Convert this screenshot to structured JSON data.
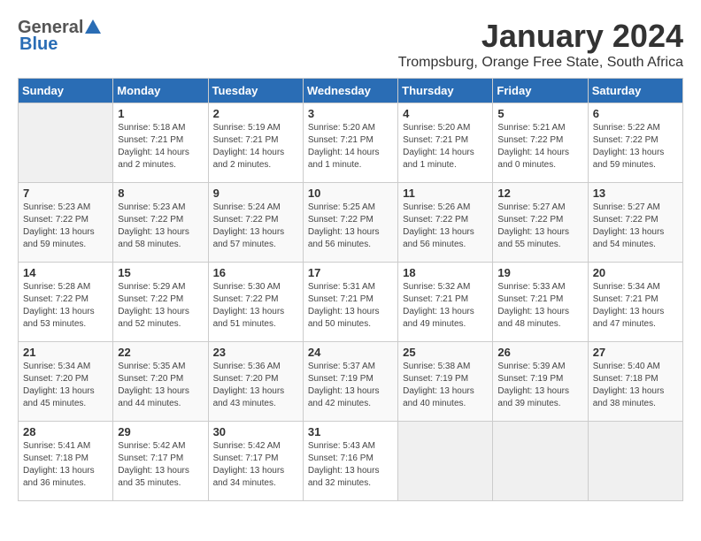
{
  "logo": {
    "general": "General",
    "blue": "Blue"
  },
  "title": "January 2024",
  "location": "Trompsburg, Orange Free State, South Africa",
  "days_header": [
    "Sunday",
    "Monday",
    "Tuesday",
    "Wednesday",
    "Thursday",
    "Friday",
    "Saturday"
  ],
  "weeks": [
    [
      {
        "day": "",
        "sunrise": "",
        "sunset": "",
        "daylight": ""
      },
      {
        "day": "1",
        "sunrise": "Sunrise: 5:18 AM",
        "sunset": "Sunset: 7:21 PM",
        "daylight": "Daylight: 14 hours and 2 minutes."
      },
      {
        "day": "2",
        "sunrise": "Sunrise: 5:19 AM",
        "sunset": "Sunset: 7:21 PM",
        "daylight": "Daylight: 14 hours and 2 minutes."
      },
      {
        "day": "3",
        "sunrise": "Sunrise: 5:20 AM",
        "sunset": "Sunset: 7:21 PM",
        "daylight": "Daylight: 14 hours and 1 minute."
      },
      {
        "day": "4",
        "sunrise": "Sunrise: 5:20 AM",
        "sunset": "Sunset: 7:21 PM",
        "daylight": "Daylight: 14 hours and 1 minute."
      },
      {
        "day": "5",
        "sunrise": "Sunrise: 5:21 AM",
        "sunset": "Sunset: 7:22 PM",
        "daylight": "Daylight: 14 hours and 0 minutes."
      },
      {
        "day": "6",
        "sunrise": "Sunrise: 5:22 AM",
        "sunset": "Sunset: 7:22 PM",
        "daylight": "Daylight: 13 hours and 59 minutes."
      }
    ],
    [
      {
        "day": "7",
        "sunrise": "Sunrise: 5:23 AM",
        "sunset": "Sunset: 7:22 PM",
        "daylight": "Daylight: 13 hours and 59 minutes."
      },
      {
        "day": "8",
        "sunrise": "Sunrise: 5:23 AM",
        "sunset": "Sunset: 7:22 PM",
        "daylight": "Daylight: 13 hours and 58 minutes."
      },
      {
        "day": "9",
        "sunrise": "Sunrise: 5:24 AM",
        "sunset": "Sunset: 7:22 PM",
        "daylight": "Daylight: 13 hours and 57 minutes."
      },
      {
        "day": "10",
        "sunrise": "Sunrise: 5:25 AM",
        "sunset": "Sunset: 7:22 PM",
        "daylight": "Daylight: 13 hours and 56 minutes."
      },
      {
        "day": "11",
        "sunrise": "Sunrise: 5:26 AM",
        "sunset": "Sunset: 7:22 PM",
        "daylight": "Daylight: 13 hours and 56 minutes."
      },
      {
        "day": "12",
        "sunrise": "Sunrise: 5:27 AM",
        "sunset": "Sunset: 7:22 PM",
        "daylight": "Daylight: 13 hours and 55 minutes."
      },
      {
        "day": "13",
        "sunrise": "Sunrise: 5:27 AM",
        "sunset": "Sunset: 7:22 PM",
        "daylight": "Daylight: 13 hours and 54 minutes."
      }
    ],
    [
      {
        "day": "14",
        "sunrise": "Sunrise: 5:28 AM",
        "sunset": "Sunset: 7:22 PM",
        "daylight": "Daylight: 13 hours and 53 minutes."
      },
      {
        "day": "15",
        "sunrise": "Sunrise: 5:29 AM",
        "sunset": "Sunset: 7:22 PM",
        "daylight": "Daylight: 13 hours and 52 minutes."
      },
      {
        "day": "16",
        "sunrise": "Sunrise: 5:30 AM",
        "sunset": "Sunset: 7:22 PM",
        "daylight": "Daylight: 13 hours and 51 minutes."
      },
      {
        "day": "17",
        "sunrise": "Sunrise: 5:31 AM",
        "sunset": "Sunset: 7:21 PM",
        "daylight": "Daylight: 13 hours and 50 minutes."
      },
      {
        "day": "18",
        "sunrise": "Sunrise: 5:32 AM",
        "sunset": "Sunset: 7:21 PM",
        "daylight": "Daylight: 13 hours and 49 minutes."
      },
      {
        "day": "19",
        "sunrise": "Sunrise: 5:33 AM",
        "sunset": "Sunset: 7:21 PM",
        "daylight": "Daylight: 13 hours and 48 minutes."
      },
      {
        "day": "20",
        "sunrise": "Sunrise: 5:34 AM",
        "sunset": "Sunset: 7:21 PM",
        "daylight": "Daylight: 13 hours and 47 minutes."
      }
    ],
    [
      {
        "day": "21",
        "sunrise": "Sunrise: 5:34 AM",
        "sunset": "Sunset: 7:20 PM",
        "daylight": "Daylight: 13 hours and 45 minutes."
      },
      {
        "day": "22",
        "sunrise": "Sunrise: 5:35 AM",
        "sunset": "Sunset: 7:20 PM",
        "daylight": "Daylight: 13 hours and 44 minutes."
      },
      {
        "day": "23",
        "sunrise": "Sunrise: 5:36 AM",
        "sunset": "Sunset: 7:20 PM",
        "daylight": "Daylight: 13 hours and 43 minutes."
      },
      {
        "day": "24",
        "sunrise": "Sunrise: 5:37 AM",
        "sunset": "Sunset: 7:19 PM",
        "daylight": "Daylight: 13 hours and 42 minutes."
      },
      {
        "day": "25",
        "sunrise": "Sunrise: 5:38 AM",
        "sunset": "Sunset: 7:19 PM",
        "daylight": "Daylight: 13 hours and 40 minutes."
      },
      {
        "day": "26",
        "sunrise": "Sunrise: 5:39 AM",
        "sunset": "Sunset: 7:19 PM",
        "daylight": "Daylight: 13 hours and 39 minutes."
      },
      {
        "day": "27",
        "sunrise": "Sunrise: 5:40 AM",
        "sunset": "Sunset: 7:18 PM",
        "daylight": "Daylight: 13 hours and 38 minutes."
      }
    ],
    [
      {
        "day": "28",
        "sunrise": "Sunrise: 5:41 AM",
        "sunset": "Sunset: 7:18 PM",
        "daylight": "Daylight: 13 hours and 36 minutes."
      },
      {
        "day": "29",
        "sunrise": "Sunrise: 5:42 AM",
        "sunset": "Sunset: 7:17 PM",
        "daylight": "Daylight: 13 hours and 35 minutes."
      },
      {
        "day": "30",
        "sunrise": "Sunrise: 5:42 AM",
        "sunset": "Sunset: 7:17 PM",
        "daylight": "Daylight: 13 hours and 34 minutes."
      },
      {
        "day": "31",
        "sunrise": "Sunrise: 5:43 AM",
        "sunset": "Sunset: 7:16 PM",
        "daylight": "Daylight: 13 hours and 32 minutes."
      },
      {
        "day": "",
        "sunrise": "",
        "sunset": "",
        "daylight": ""
      },
      {
        "day": "",
        "sunrise": "",
        "sunset": "",
        "daylight": ""
      },
      {
        "day": "",
        "sunrise": "",
        "sunset": "",
        "daylight": ""
      }
    ]
  ]
}
